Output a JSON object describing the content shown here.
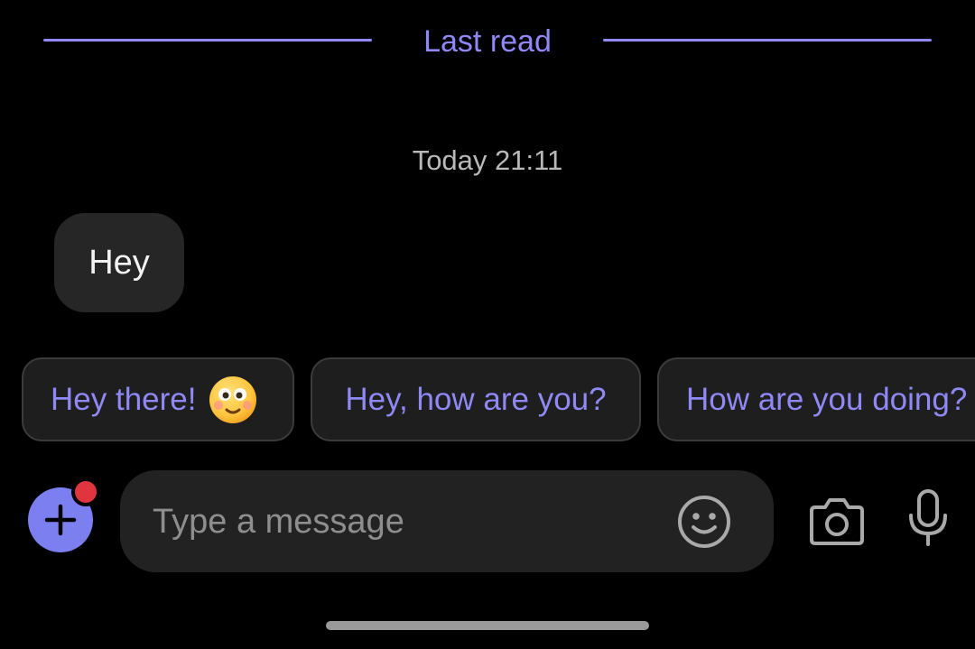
{
  "colors": {
    "accent": "#8f88f5",
    "accent_button": "#7c7ff0",
    "badge": "#e0353f",
    "icon_gray": "#a9a9a9"
  },
  "divider": {
    "label": "Last read"
  },
  "chat": {
    "timestamp": "Today 21:11",
    "messages": [
      {
        "text": "Hey"
      }
    ]
  },
  "smart_replies": [
    {
      "text": "Hey there!",
      "icon": "smiling-face-emoji"
    },
    {
      "text": "Hey, how are you?"
    },
    {
      "text": "How are you doing?"
    }
  ],
  "composer": {
    "placeholder": "Type a message",
    "icons": [
      "plus-icon",
      "emoji-icon",
      "camera-icon",
      "microphone-icon"
    ]
  }
}
